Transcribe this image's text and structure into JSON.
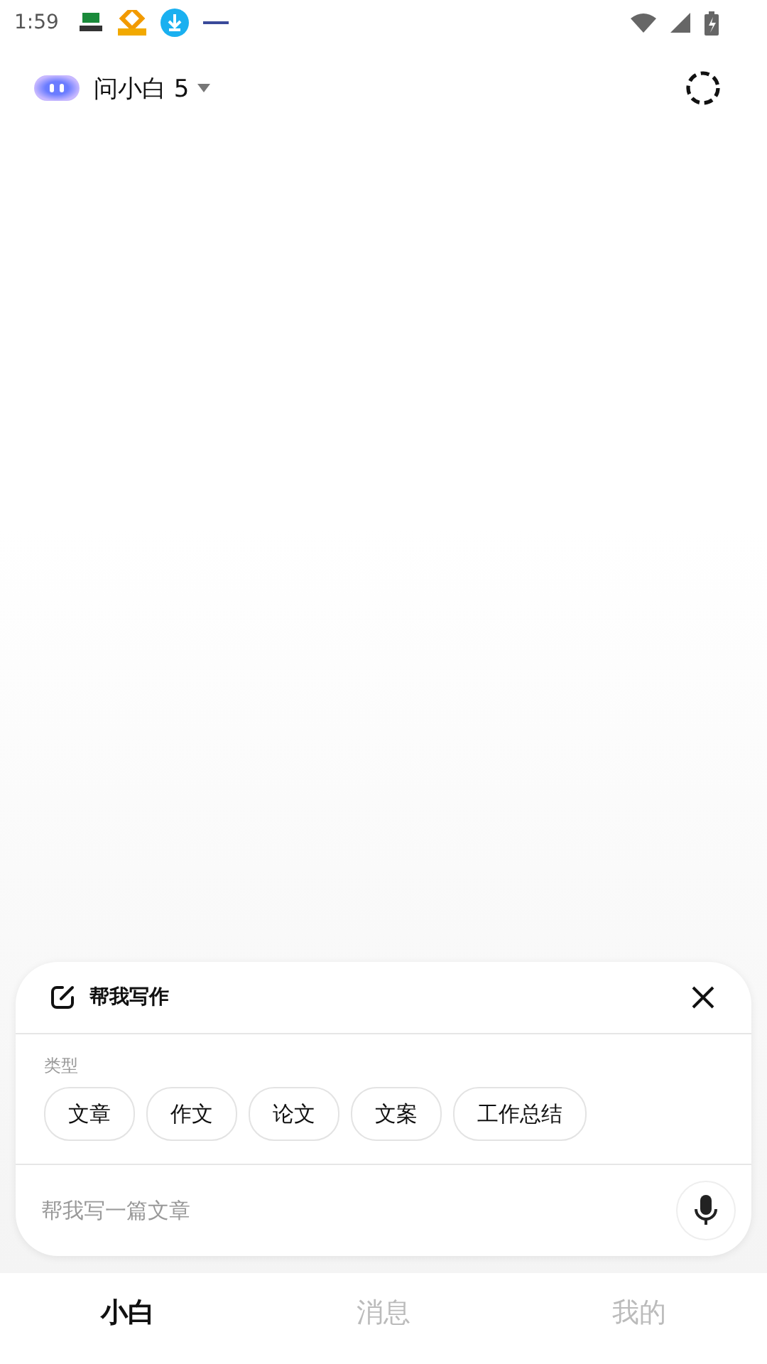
{
  "status_bar": {
    "time": "1:59"
  },
  "header": {
    "title": "问小白 5"
  },
  "writing_panel": {
    "title": "帮我写作",
    "section_label": "类型",
    "chips": [
      "文章",
      "作文",
      "论文",
      "文案",
      "工作总结"
    ],
    "input": {
      "placeholder": "帮我写一篇文章"
    }
  },
  "tabs": [
    {
      "label": "小白",
      "selected": true
    },
    {
      "label": "消息",
      "selected": false
    },
    {
      "label": "我的",
      "selected": false
    }
  ]
}
